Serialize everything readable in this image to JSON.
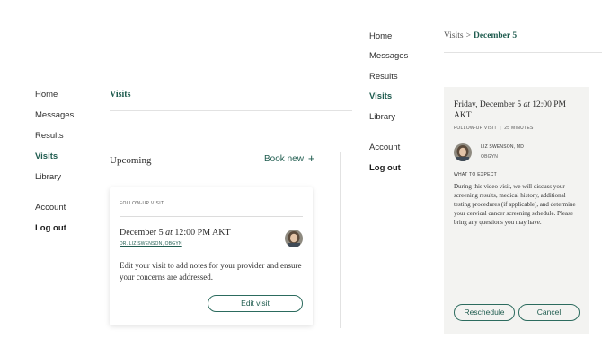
{
  "nav_left": {
    "items": [
      "Home",
      "Messages",
      "Results",
      "Visits",
      "Library"
    ],
    "account": "Account",
    "logout": "Log out"
  },
  "nav_right": {
    "items": [
      "Home",
      "Messages",
      "Results",
      "Visits",
      "Library"
    ],
    "account": "Account",
    "logout": "Log out"
  },
  "visits": {
    "title": "Visits",
    "upcoming": "Upcoming",
    "book_new": "Book new",
    "book_new_icon": "plus-icon"
  },
  "card": {
    "kind": "FOLLOW-UP VISIT",
    "date": "December 5",
    "at": "at",
    "time": "12:00 PM AKT",
    "doctor": "DR. LIZ SWENSON, OBGYN",
    "note": "Edit your visit to add notes for your provider and ensure your concerns are addressed.",
    "edit_button": "Edit visit"
  },
  "breadcrumb": {
    "parent": "Visits",
    "separator": ">",
    "current": "December 5"
  },
  "detail": {
    "date": "Friday, December 5",
    "at": "at",
    "time": "12:00 PM AKT",
    "meta": "FOLLOW-UP VISIT  |  25 MINUTES",
    "doctor_name": "LIZ SWENSON, MD",
    "doctor_specialty": "OBGYN",
    "expect_heading": "WHAT TO EXPECT",
    "expect_text": "During this video visit, we will discuss your screening results, medical history, additional testing procedures (if applicable), and determine your cervical cancer screening schedule. Please bring any questions you may have.",
    "reschedule_button": "Reschedule",
    "cancel_button": "Cancel"
  },
  "colors": {
    "accent": "#1f5c4f",
    "panel_bg": "#f3f3f1",
    "divider": "#e2e2e2"
  }
}
